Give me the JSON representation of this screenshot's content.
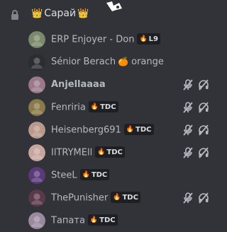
{
  "channel": {
    "name": "Сарай",
    "crown_left": "👑",
    "crown_right": "👑"
  },
  "users": [
    {
      "name": "ERP Enjoyer - Don",
      "tag": "L9",
      "tag_icon": "🔥",
      "bold": false,
      "muted": false,
      "avatar_color": "#7a8a6a"
    },
    {
      "name": "Sénior Berach",
      "suffix_emoji": "🍊",
      "suffix_text": "orange",
      "bold": false,
      "muted": false,
      "avatar_color": "#2b2d31"
    },
    {
      "name": "Anjellaaaa",
      "bold": true,
      "muted": true,
      "avatar_color": "#9a7a8a"
    },
    {
      "name": "Fenriria",
      "tag": "TDC",
      "tag_icon": "🔥",
      "bold": false,
      "muted": true,
      "avatar_color": "#8a7a4a"
    },
    {
      "name": "Heisenberg691",
      "tag": "TDC",
      "tag_icon": "🔥",
      "bold": false,
      "muted": true,
      "avatar_color": "#b8998a"
    },
    {
      "name": "IlTRYMEll",
      "tag": "TDC",
      "tag_icon": "🔥",
      "bold": false,
      "muted": true,
      "avatar_color": "#c8a6a0"
    },
    {
      "name": "SteeL",
      "tag": "TDC",
      "tag_icon": "🔥",
      "bold": false,
      "muted": false,
      "avatar_color": "#5a3a7a"
    },
    {
      "name": "ThePunisher",
      "tag": "TDC",
      "tag_icon": "🔥",
      "bold": false,
      "muted": true,
      "avatar_color": "#5a3a4a"
    },
    {
      "name": "Тапата",
      "tag": "TDC",
      "tag_icon": "🔥",
      "bold": false,
      "muted": false,
      "avatar_color": "#9a8aa0"
    }
  ],
  "icons": {
    "lock": "lock-icon",
    "mic_off": "mic-muted-icon",
    "headphones_off": "deafened-icon"
  }
}
